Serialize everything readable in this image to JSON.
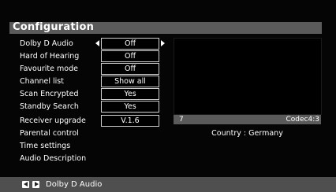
{
  "title": "Configuration",
  "menu": {
    "items": [
      {
        "label": "Dolby D Audio",
        "value": "Off"
      },
      {
        "label": "Hard of Hearing",
        "value": "Off"
      },
      {
        "label": "Favourite mode",
        "value": "Off"
      },
      {
        "label": "Channel list",
        "value": "Show all"
      },
      {
        "label": "Scan Encrypted",
        "value": "Yes"
      },
      {
        "label": "Standby Search",
        "value": "Yes"
      },
      {
        "label": "Receiver upgrade",
        "value": "V.1.6"
      },
      {
        "label": "Parental control"
      },
      {
        "label": "Time settings"
      },
      {
        "label": "Audio Description"
      }
    ]
  },
  "preview": {
    "channel_number": "7",
    "codec": "Codec4:3",
    "country": "Country : Germany"
  },
  "footer": {
    "hint": "Dolby D Audio",
    "icons": [
      "left-arrow-key-icon",
      "right-arrow-key-icon"
    ]
  },
  "colors": {
    "background": "#050505",
    "bar": "#5a5a5a",
    "footer": "#4f4f4f",
    "text": "#ffffff"
  }
}
